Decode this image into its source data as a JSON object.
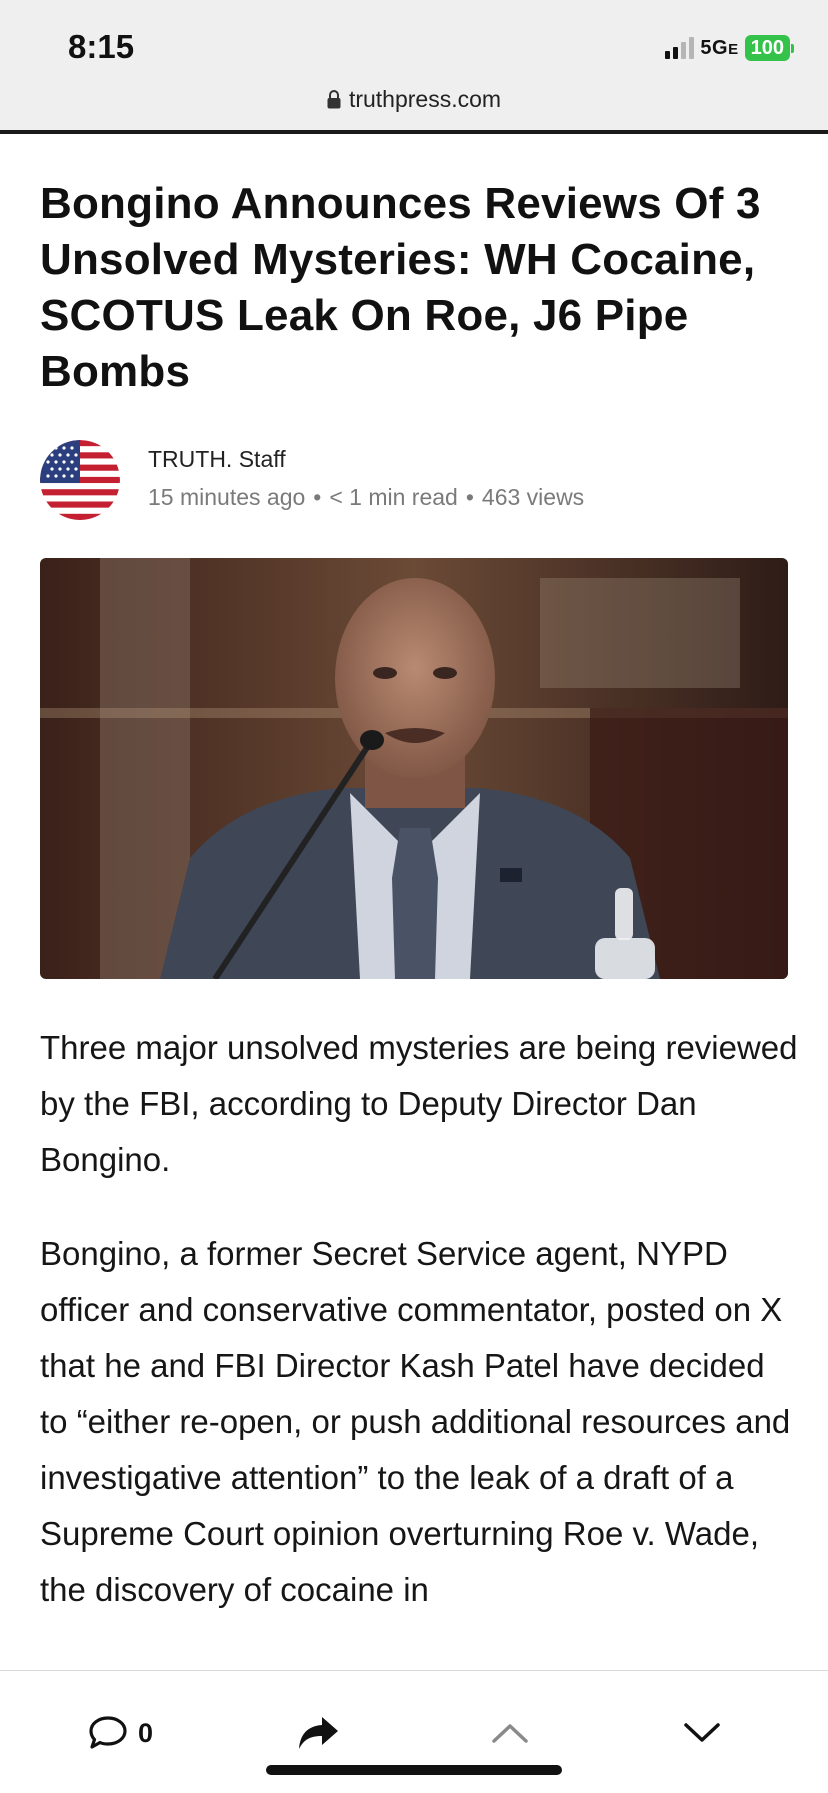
{
  "status_bar": {
    "time": "8:15",
    "network": "5G",
    "network_suffix": "E",
    "battery": "100"
  },
  "url_bar": {
    "domain": "truthpress.com"
  },
  "article": {
    "headline": "Bongino Announces Reviews Of 3 Unsolved Mysteries: WH Cocaine, SCOTUS Leak On Roe, J6 Pipe Bombs",
    "author": "TRUTH. Staff",
    "published": "15 minutes ago",
    "read_time": "< 1 min read",
    "views": "463 views",
    "paragraphs": [
      "Three major unsolved mysteries are being reviewed by the FBI, according to Deputy Director Dan Bongino.",
      "Bongino, a former Secret Service agent, NYPD officer and conservative commentator, posted on X that he and FBI Director Kash Patel have decided to “either re-open, or push additional resources and investigative attention” to the leak of a draft of a Supreme Court opinion overturning Roe v. Wade, the discovery of cocaine in"
    ]
  },
  "bottom_bar": {
    "comment_count": "0",
    "icons": [
      "comment-icon",
      "share-icon",
      "chevron-up-icon",
      "chevron-down-icon"
    ]
  },
  "colors": {
    "battery": "#35c24a",
    "meta_text": "#7a7a7a",
    "topbar_bg": "#efefef"
  }
}
